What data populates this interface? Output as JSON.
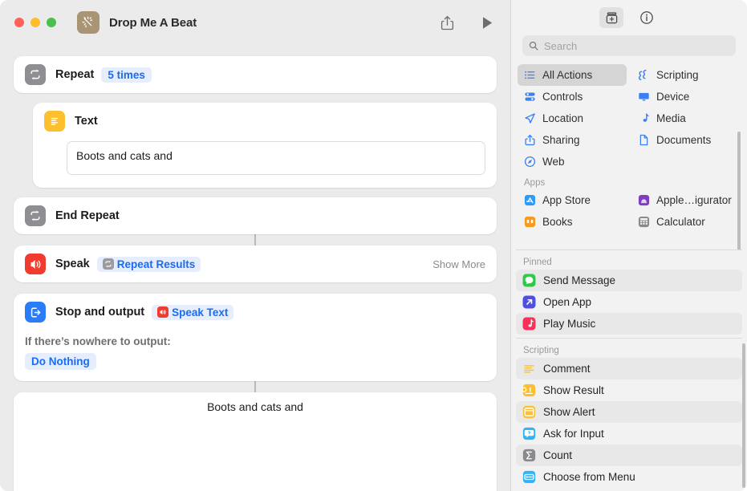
{
  "window": {
    "title": "Drop Me A Beat",
    "traffic_lights": [
      "close",
      "minimize",
      "zoom"
    ],
    "app_icon": "shortcuts-wand-icon",
    "toolbar": {
      "share_label": "share-icon",
      "run_label": "play-icon"
    }
  },
  "workflow": {
    "actions": [
      {
        "name": "Repeat",
        "icon": "repeat-icon",
        "icon_color": "#8e8e93",
        "token": "5 times"
      },
      {
        "name": "Text",
        "icon": "text-icon",
        "icon_color": "#fcc02e",
        "value": "Boots and cats and"
      },
      {
        "name": "End Repeat",
        "icon": "repeat-icon",
        "icon_color": "#8e8e93"
      },
      {
        "name": "Speak",
        "icon": "speaker-icon",
        "icon_color": "#f03b2e",
        "token": "Repeat Results",
        "token_icon": "repeat-mini-icon",
        "trailing": "Show More"
      },
      {
        "name": "Stop and output",
        "icon": "stop-output-icon",
        "icon_color": "#2a7cf7",
        "token": "Speak Text",
        "token_icon": "speaker-mini-icon",
        "sub_label": "If there’s nowhere to output:",
        "sub_value": "Do Nothing"
      }
    ],
    "output_preview": "Boots and cats and"
  },
  "sidebar": {
    "toolbar": {
      "library_icon": "action-library-icon",
      "info_icon": "info-circle-icon"
    },
    "search": {
      "placeholder": "Search",
      "icon": "search-icon"
    },
    "categories": [
      {
        "label": "All Actions",
        "icon": "list-bullet-icon",
        "selected": true
      },
      {
        "label": "Scripting",
        "icon": "scripting-icon",
        "selected": false
      },
      {
        "label": "Controls",
        "icon": "controls-icon",
        "selected": false
      },
      {
        "label": "Device",
        "icon": "display-icon",
        "selected": false
      },
      {
        "label": "Location",
        "icon": "location-arrow-icon",
        "selected": false
      },
      {
        "label": "Media",
        "icon": "music-note-icon",
        "selected": false
      },
      {
        "label": "Sharing",
        "icon": "share-icon",
        "selected": false
      },
      {
        "label": "Documents",
        "icon": "document-icon",
        "selected": false
      },
      {
        "label": "Web",
        "icon": "safari-compass-icon",
        "selected": false
      }
    ],
    "apps_section": {
      "header": "Apps",
      "items": [
        {
          "label": "App Store",
          "icon": "app-store-icon",
          "color": "#2e9cf7"
        },
        {
          "label": "Apple…igurator",
          "icon": "apple-configurator-icon",
          "color": "#7b3fbf"
        },
        {
          "label": "Books",
          "icon": "books-icon",
          "color": "#f59b1e"
        },
        {
          "label": "Calculator",
          "icon": "calculator-icon",
          "color": "#8a8a8e"
        }
      ]
    },
    "pinned_section": {
      "header": "Pinned",
      "items": [
        {
          "label": "Send Message",
          "icon": "messages-icon",
          "color": "#30c84b"
        },
        {
          "label": "Open App",
          "icon": "open-app-icon",
          "color": "#4f4fe0"
        },
        {
          "label": "Play Music",
          "icon": "music-icon",
          "color": "#f8305a"
        }
      ]
    },
    "scripting_section": {
      "header": "Scripting",
      "items": [
        {
          "label": "Comment",
          "icon": "comment-icon",
          "color": "#fcc02e"
        },
        {
          "label": "Show Result",
          "icon": "show-result-icon",
          "color": "#fcc02e"
        },
        {
          "label": "Show Alert",
          "icon": "show-alert-icon",
          "color": "#fcc02e"
        },
        {
          "label": "Ask for Input",
          "icon": "ask-input-icon",
          "color": "#2eb6fa"
        },
        {
          "label": "Count",
          "icon": "count-icon",
          "color": "#8a8a8e"
        },
        {
          "label": "Choose from Menu",
          "icon": "choose-menu-icon",
          "color": "#2eb6fa"
        }
      ]
    }
  }
}
